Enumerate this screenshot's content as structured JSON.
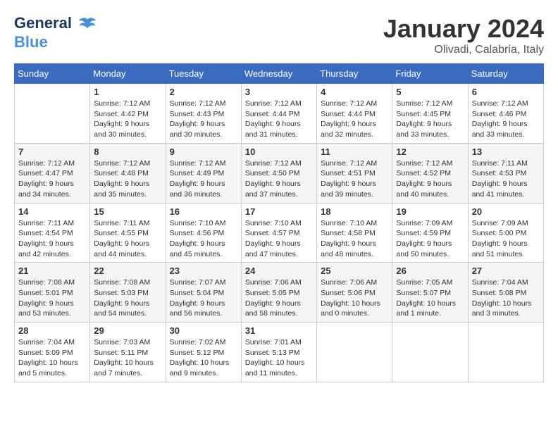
{
  "header": {
    "logo_line1": "General",
    "logo_line2": "Blue",
    "month": "January 2024",
    "location": "Olivadi, Calabria, Italy"
  },
  "days_of_week": [
    "Sunday",
    "Monday",
    "Tuesday",
    "Wednesday",
    "Thursday",
    "Friday",
    "Saturday"
  ],
  "weeks": [
    [
      {
        "day": "",
        "info": ""
      },
      {
        "day": "1",
        "info": "Sunrise: 7:12 AM\nSunset: 4:42 PM\nDaylight: 9 hours\nand 30 minutes."
      },
      {
        "day": "2",
        "info": "Sunrise: 7:12 AM\nSunset: 4:43 PM\nDaylight: 9 hours\nand 30 minutes."
      },
      {
        "day": "3",
        "info": "Sunrise: 7:12 AM\nSunset: 4:44 PM\nDaylight: 9 hours\nand 31 minutes."
      },
      {
        "day": "4",
        "info": "Sunrise: 7:12 AM\nSunset: 4:44 PM\nDaylight: 9 hours\nand 32 minutes."
      },
      {
        "day": "5",
        "info": "Sunrise: 7:12 AM\nSunset: 4:45 PM\nDaylight: 9 hours\nand 33 minutes."
      },
      {
        "day": "6",
        "info": "Sunrise: 7:12 AM\nSunset: 4:46 PM\nDaylight: 9 hours\nand 33 minutes."
      }
    ],
    [
      {
        "day": "7",
        "info": "Sunrise: 7:12 AM\nSunset: 4:47 PM\nDaylight: 9 hours\nand 34 minutes."
      },
      {
        "day": "8",
        "info": "Sunrise: 7:12 AM\nSunset: 4:48 PM\nDaylight: 9 hours\nand 35 minutes."
      },
      {
        "day": "9",
        "info": "Sunrise: 7:12 AM\nSunset: 4:49 PM\nDaylight: 9 hours\nand 36 minutes."
      },
      {
        "day": "10",
        "info": "Sunrise: 7:12 AM\nSunset: 4:50 PM\nDaylight: 9 hours\nand 37 minutes."
      },
      {
        "day": "11",
        "info": "Sunrise: 7:12 AM\nSunset: 4:51 PM\nDaylight: 9 hours\nand 39 minutes."
      },
      {
        "day": "12",
        "info": "Sunrise: 7:12 AM\nSunset: 4:52 PM\nDaylight: 9 hours\nand 40 minutes."
      },
      {
        "day": "13",
        "info": "Sunrise: 7:11 AM\nSunset: 4:53 PM\nDaylight: 9 hours\nand 41 minutes."
      }
    ],
    [
      {
        "day": "14",
        "info": "Sunrise: 7:11 AM\nSunset: 4:54 PM\nDaylight: 9 hours\nand 42 minutes."
      },
      {
        "day": "15",
        "info": "Sunrise: 7:11 AM\nSunset: 4:55 PM\nDaylight: 9 hours\nand 44 minutes."
      },
      {
        "day": "16",
        "info": "Sunrise: 7:10 AM\nSunset: 4:56 PM\nDaylight: 9 hours\nand 45 minutes."
      },
      {
        "day": "17",
        "info": "Sunrise: 7:10 AM\nSunset: 4:57 PM\nDaylight: 9 hours\nand 47 minutes."
      },
      {
        "day": "18",
        "info": "Sunrise: 7:10 AM\nSunset: 4:58 PM\nDaylight: 9 hours\nand 48 minutes."
      },
      {
        "day": "19",
        "info": "Sunrise: 7:09 AM\nSunset: 4:59 PM\nDaylight: 9 hours\nand 50 minutes."
      },
      {
        "day": "20",
        "info": "Sunrise: 7:09 AM\nSunset: 5:00 PM\nDaylight: 9 hours\nand 51 minutes."
      }
    ],
    [
      {
        "day": "21",
        "info": "Sunrise: 7:08 AM\nSunset: 5:01 PM\nDaylight: 9 hours\nand 53 minutes."
      },
      {
        "day": "22",
        "info": "Sunrise: 7:08 AM\nSunset: 5:03 PM\nDaylight: 9 hours\nand 54 minutes."
      },
      {
        "day": "23",
        "info": "Sunrise: 7:07 AM\nSunset: 5:04 PM\nDaylight: 9 hours\nand 56 minutes."
      },
      {
        "day": "24",
        "info": "Sunrise: 7:06 AM\nSunset: 5:05 PM\nDaylight: 9 hours\nand 58 minutes."
      },
      {
        "day": "25",
        "info": "Sunrise: 7:06 AM\nSunset: 5:06 PM\nDaylight: 10 hours\nand 0 minutes."
      },
      {
        "day": "26",
        "info": "Sunrise: 7:05 AM\nSunset: 5:07 PM\nDaylight: 10 hours\nand 1 minute."
      },
      {
        "day": "27",
        "info": "Sunrise: 7:04 AM\nSunset: 5:08 PM\nDaylight: 10 hours\nand 3 minutes."
      }
    ],
    [
      {
        "day": "28",
        "info": "Sunrise: 7:04 AM\nSunset: 5:09 PM\nDaylight: 10 hours\nand 5 minutes."
      },
      {
        "day": "29",
        "info": "Sunrise: 7:03 AM\nSunset: 5:11 PM\nDaylight: 10 hours\nand 7 minutes."
      },
      {
        "day": "30",
        "info": "Sunrise: 7:02 AM\nSunset: 5:12 PM\nDaylight: 10 hours\nand 9 minutes."
      },
      {
        "day": "31",
        "info": "Sunrise: 7:01 AM\nSunset: 5:13 PM\nDaylight: 10 hours\nand 11 minutes."
      },
      {
        "day": "",
        "info": ""
      },
      {
        "day": "",
        "info": ""
      },
      {
        "day": "",
        "info": ""
      }
    ]
  ]
}
